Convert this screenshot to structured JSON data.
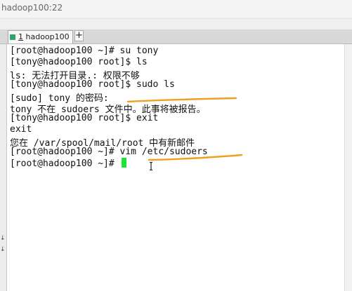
{
  "window": {
    "title": "hadoop100:22"
  },
  "tabs": {
    "items": [
      {
        "index": "1",
        "label": "hadoop100"
      }
    ],
    "add_label": "+"
  },
  "gutter": {
    "marks": [
      "↓",
      "↓"
    ]
  },
  "terminal": {
    "lines": [
      "[root@hadoop100 ~]# su tony",
      "[tony@hadoop100 root]$ ls",
      "ls: 无法打开目录.: 权限不够",
      "[tony@hadoop100 root]$ sudo ls",
      "[sudo] tony 的密码:",
      "tony 不在 sudoers 文件中。此事将被报告。",
      "[tony@hadoop100 root]$ exit",
      "exit",
      "您在 /var/spool/mail/root 中有新邮件",
      "[root@hadoop100 ~]# vim /etc/sudoers",
      "[root@hadoop100 ~]# "
    ],
    "cursor_color": "#19e632"
  },
  "annotations": {
    "stroke_color": "#f0a020"
  }
}
